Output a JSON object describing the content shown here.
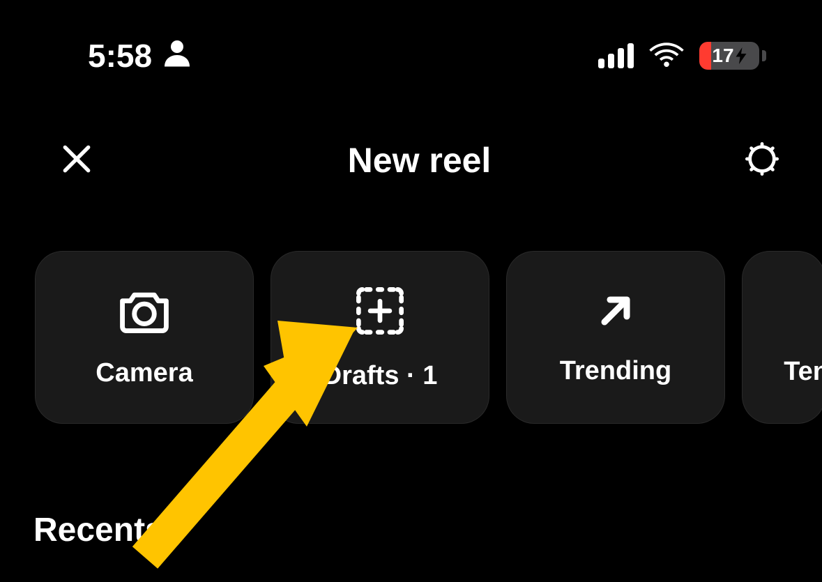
{
  "status": {
    "time": "5:58",
    "battery_percent": "17"
  },
  "header": {
    "title": "New reel"
  },
  "tiles": [
    {
      "label": "Camera"
    },
    {
      "label": "Drafts · 1"
    },
    {
      "label": "Trending"
    },
    {
      "label": "Ten"
    }
  ],
  "recents": {
    "label": "Recents"
  }
}
